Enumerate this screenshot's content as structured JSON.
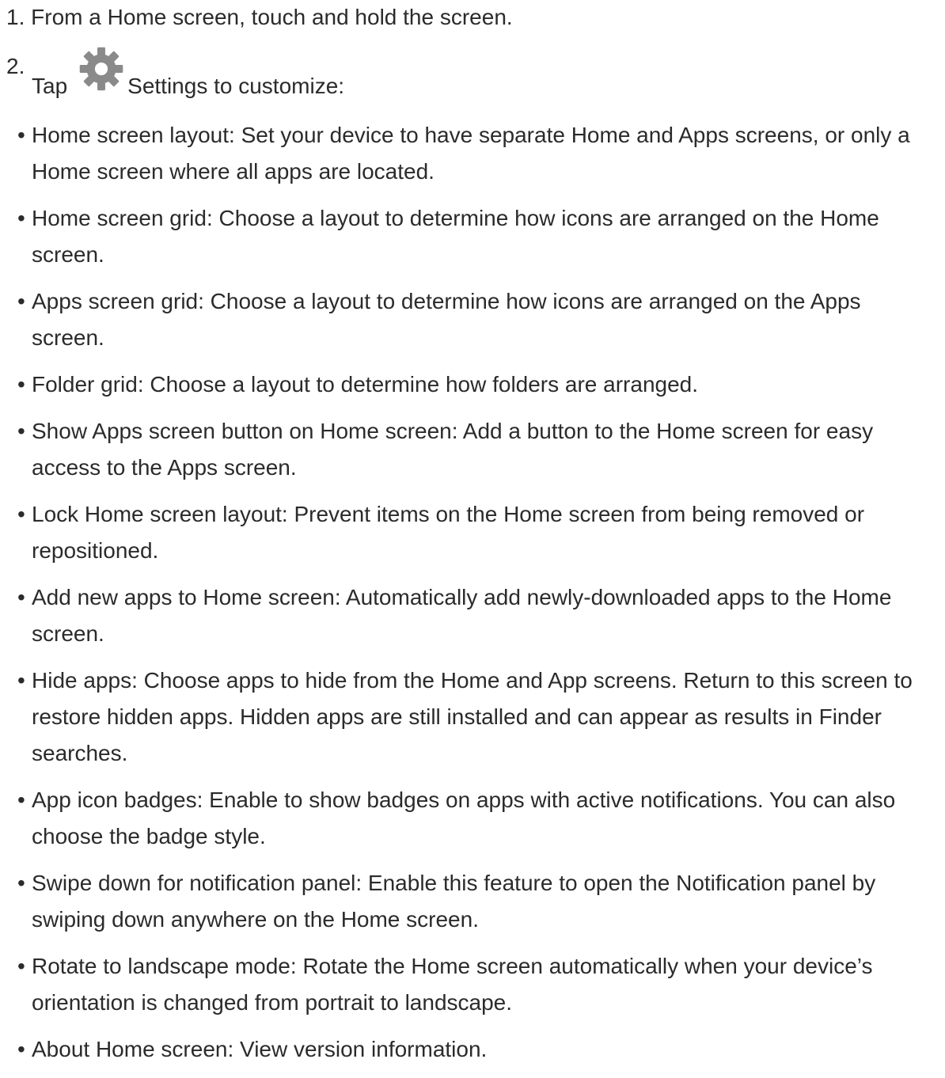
{
  "steps": [
    {
      "number": "1.",
      "text": "From a Home screen, touch and hold the screen."
    },
    {
      "number": "2.",
      "prefix": "Tap",
      "icon": "gear-icon",
      "suffix": "Settings to customize:"
    }
  ],
  "options": [
    "Home screen layout: Set your device to have separate Home and Apps screens, or only a Home screen where all apps are located.",
    "Home screen grid: Choose a layout to determine how icons are arranged on the Home screen.",
    "Apps screen grid: Choose a layout to determine how icons are arranged on the Apps screen.",
    "Folder grid: Choose a layout to determine how folders are arranged.",
    "Show Apps screen button on Home screen: Add a button to the Home screen for easy access to the Apps screen.",
    "Lock Home screen layout: Prevent items on the Home screen from being removed or repositioned.",
    "Add new apps to Home screen: Automatically add newly-downloaded apps to the Home screen.",
    "Hide apps: Choose apps to hide from the Home and App screens. Return to this screen to restore hidden apps. Hidden apps are still installed and can appear as results in Finder searches.",
    "App icon badges: Enable to show badges on apps with active notifications. You can also choose the badge style.",
    "Swipe down for notification panel: Enable this feature to open the Notification panel by swiping down anywhere on the Home screen.",
    "Rotate to landscape mode: Rotate the Home screen automatically when your device’s orientation is changed from portrait to landscape.",
    "About Home screen: View version information."
  ],
  "colors": {
    "text": "#2b2b2b",
    "icon": "#8a8a8a"
  }
}
